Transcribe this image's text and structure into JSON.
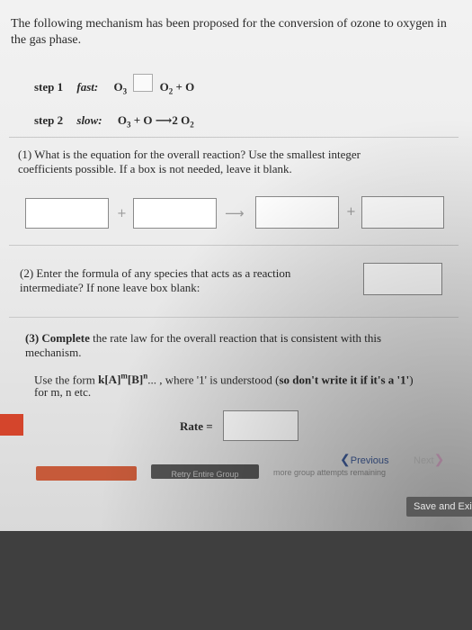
{
  "intro": "The following mechanism has been proposed for the conversion of ozone to oxygen in the gas phase.",
  "step1": {
    "label": "step 1",
    "speed": "fast:",
    "reactant": "O",
    "reactant_sub": "3",
    "product": "O",
    "product_sub": "2",
    "product_extra": " + O"
  },
  "step2": {
    "label": "step 2",
    "speed": "slow:",
    "lhs": "O",
    "lhs_sub": "3",
    "lhs_extra": " + O ",
    "arrow": "⟶",
    "rhs": "2 O",
    "rhs_sub": "2"
  },
  "q1": {
    "text": "(1) What is the equation for the overall reaction? Use the smallest integer coefficients possible. If a box is not needed, leave it blank.",
    "plus": "+",
    "arrow": "⟶"
  },
  "q2": {
    "text": "(2) Enter the formula of any species that acts as a reaction intermediate? If none leave box blank:"
  },
  "q3": {
    "bold_part": "(3) Complete",
    "text_part": " the rate law for the overall reaction that is consistent with this mechanism.",
    "form_intro": "Use the form ",
    "form_expr": "k[A]",
    "form_m": "m",
    "form_b": "[B]",
    "form_n": "n",
    "form_dots": "... , where '1' is understood (",
    "form_bold": "so don't write it if it's a '1'",
    "form_end": ")",
    "form_line2": "for m, n etc."
  },
  "rate_label": "Rate =",
  "nav": {
    "previous": "Previous",
    "next": "Next"
  },
  "bottom": {
    "gray_button": "Retry Entire Group",
    "faint_text": "more group attempts remaining",
    "save": "Save and Exit"
  },
  "colors": {
    "accent_red": "#c65a3a",
    "link_blue": "#3e5a96"
  }
}
